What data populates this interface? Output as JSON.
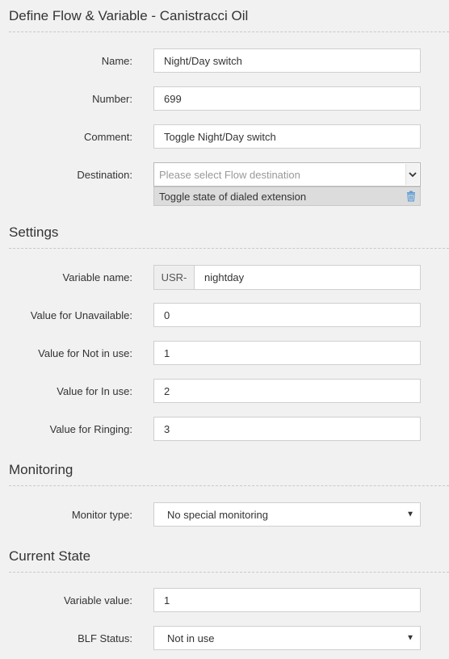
{
  "define": {
    "title": "Define Flow & Variable - Canistracci Oil",
    "name_label": "Name:",
    "name_value": "Night/Day switch",
    "number_label": "Number:",
    "number_value": "699",
    "comment_label": "Comment:",
    "comment_value": "Toggle Night/Day switch",
    "destination_label": "Destination:",
    "destination_placeholder": "Please select Flow destination",
    "destination_selected": "Toggle state of dialed extension"
  },
  "settings": {
    "title": "Settings",
    "variable_name_label": "Variable name:",
    "variable_prefix": "USR-",
    "variable_name_value": "nightday",
    "unavailable_label": "Value for Unavailable:",
    "unavailable_value": "0",
    "not_in_use_label": "Value for Not in use:",
    "not_in_use_value": "1",
    "in_use_label": "Value for In use:",
    "in_use_value": "2",
    "ringing_label": "Value for Ringing:",
    "ringing_value": "3"
  },
  "monitoring": {
    "title": "Monitoring",
    "monitor_type_label": "Monitor type:",
    "monitor_type_value": "No special monitoring"
  },
  "current_state": {
    "title": "Current State",
    "variable_value_label": "Variable value:",
    "variable_value": "1",
    "blf_status_label": "BLF Status:",
    "blf_status_value": "Not in use"
  },
  "icons": {
    "trash": "trash-icon",
    "select_arrow": "caret-down-icon",
    "chevron": "chevron-down-icon"
  },
  "colors": {
    "background": "#f1f1f1",
    "trash_icon": "#5b9bd5"
  }
}
